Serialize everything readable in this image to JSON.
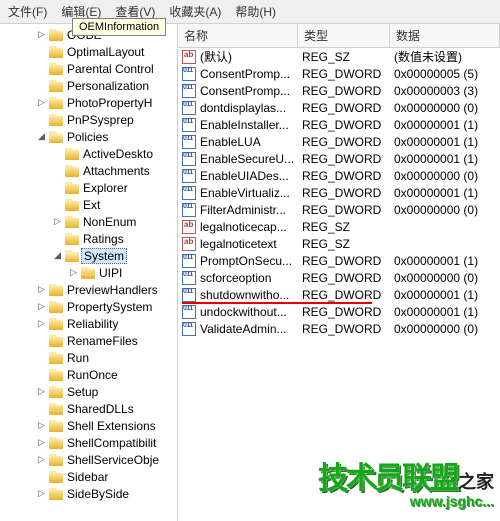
{
  "menu": {
    "file": "文件(F)",
    "edit": "编辑(E)",
    "view": "查看(V)",
    "fav": "收藏夹(A)",
    "help": "帮助(H)"
  },
  "tooltip": "OEMInformation",
  "tree": [
    {
      "indent": 2,
      "exp": "▷",
      "label": "OOBE"
    },
    {
      "indent": 2,
      "exp": "",
      "label": "OptimalLayout"
    },
    {
      "indent": 2,
      "exp": "",
      "label": "Parental Control"
    },
    {
      "indent": 2,
      "exp": "",
      "label": "Personalization"
    },
    {
      "indent": 2,
      "exp": "▷",
      "label": "PhotoPropertyH"
    },
    {
      "indent": 2,
      "exp": "",
      "label": "PnPSysprep"
    },
    {
      "indent": 2,
      "exp": "◢",
      "label": "Policies",
      "open": true
    },
    {
      "indent": 3,
      "exp": "",
      "label": "ActiveDeskto"
    },
    {
      "indent": 3,
      "exp": "",
      "label": "Attachments"
    },
    {
      "indent": 3,
      "exp": "",
      "label": "Explorer"
    },
    {
      "indent": 3,
      "exp": "",
      "label": "Ext"
    },
    {
      "indent": 3,
      "exp": "▷",
      "label": "NonEnum"
    },
    {
      "indent": 3,
      "exp": "",
      "label": "Ratings"
    },
    {
      "indent": 3,
      "exp": "◢",
      "label": "System",
      "open": true,
      "selected": true
    },
    {
      "indent": 4,
      "exp": "▷",
      "label": "UIPI"
    },
    {
      "indent": 2,
      "exp": "▷",
      "label": "PreviewHandlers"
    },
    {
      "indent": 2,
      "exp": "▷",
      "label": "PropertySystem"
    },
    {
      "indent": 2,
      "exp": "▷",
      "label": "Reliability"
    },
    {
      "indent": 2,
      "exp": "",
      "label": "RenameFiles"
    },
    {
      "indent": 2,
      "exp": "",
      "label": "Run"
    },
    {
      "indent": 2,
      "exp": "",
      "label": "RunOnce"
    },
    {
      "indent": 2,
      "exp": "▷",
      "label": "Setup"
    },
    {
      "indent": 2,
      "exp": "",
      "label": "SharedDLLs"
    },
    {
      "indent": 2,
      "exp": "▷",
      "label": "Shell Extensions"
    },
    {
      "indent": 2,
      "exp": "▷",
      "label": "ShellCompatibilit"
    },
    {
      "indent": 2,
      "exp": "▷",
      "label": "ShellServiceObje"
    },
    {
      "indent": 2,
      "exp": "",
      "label": "Sidebar"
    },
    {
      "indent": 2,
      "exp": "▷",
      "label": "SideBySide"
    }
  ],
  "columns": {
    "name": "名称",
    "type": "类型",
    "data": "数据"
  },
  "rows": [
    {
      "icon": "sz",
      "name": "(默认)",
      "type": "REG_SZ",
      "data": "(数值未设置)"
    },
    {
      "icon": "dw",
      "name": "ConsentPromp...",
      "type": "REG_DWORD",
      "data": "0x00000005 (5)"
    },
    {
      "icon": "dw",
      "name": "ConsentPromp...",
      "type": "REG_DWORD",
      "data": "0x00000003 (3)"
    },
    {
      "icon": "dw",
      "name": "dontdisplaylas...",
      "type": "REG_DWORD",
      "data": "0x00000000 (0)"
    },
    {
      "icon": "dw",
      "name": "EnableInstaller...",
      "type": "REG_DWORD",
      "data": "0x00000001 (1)"
    },
    {
      "icon": "dw",
      "name": "EnableLUA",
      "type": "REG_DWORD",
      "data": "0x00000001 (1)"
    },
    {
      "icon": "dw",
      "name": "EnableSecureU...",
      "type": "REG_DWORD",
      "data": "0x00000001 (1)"
    },
    {
      "icon": "dw",
      "name": "EnableUIADes...",
      "type": "REG_DWORD",
      "data": "0x00000000 (0)"
    },
    {
      "icon": "dw",
      "name": "EnableVirtualiz...",
      "type": "REG_DWORD",
      "data": "0x00000001 (1)"
    },
    {
      "icon": "dw",
      "name": "FilterAdministr...",
      "type": "REG_DWORD",
      "data": "0x00000000 (0)"
    },
    {
      "icon": "sz",
      "name": "legalnoticecap...",
      "type": "REG_SZ",
      "data": ""
    },
    {
      "icon": "sz",
      "name": "legalnoticetext",
      "type": "REG_SZ",
      "data": ""
    },
    {
      "icon": "dw",
      "name": "PromptOnSecu...",
      "type": "REG_DWORD",
      "data": "0x00000001 (1)"
    },
    {
      "icon": "dw",
      "name": "scforceoption",
      "type": "REG_DWORD",
      "data": "0x00000000 (0)"
    },
    {
      "icon": "dw",
      "name": "shutdownwitho...",
      "type": "REG_DWORD",
      "data": "0x00000001 (1)",
      "underline": true
    },
    {
      "icon": "dw",
      "name": "undockwithout...",
      "type": "REG_DWORD",
      "data": "0x00000001 (1)"
    },
    {
      "icon": "dw",
      "name": "ValidateAdmin...",
      "type": "REG_DWORD",
      "data": "0x00000000 (0)"
    }
  ],
  "watermark": {
    "big": "技术员联盟",
    "suffix": "之家",
    "url": "www.jsghc..."
  }
}
